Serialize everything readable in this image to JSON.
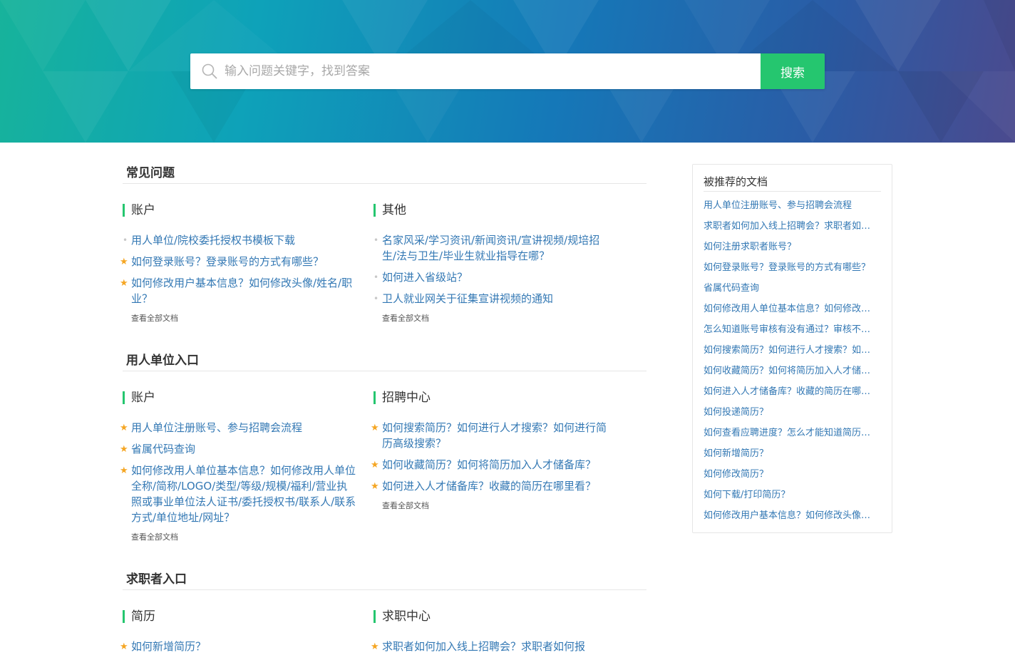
{
  "search": {
    "placeholder": "输入问题关键字，找到答案",
    "button_label": "搜索"
  },
  "sections": [
    {
      "title": "常见问题",
      "categories": [
        {
          "title": "账户",
          "items": [
            {
              "text": "用人单位/院校委托授权书模板下载",
              "starred": false
            },
            {
              "text": "如何登录账号？登录账号的方式有哪些？",
              "starred": true
            },
            {
              "text": "如何修改用户基本信息？如何修改头像/姓名/职业？",
              "starred": true
            }
          ],
          "view_all": "查看全部文档"
        },
        {
          "title": "其他",
          "items": [
            {
              "text": "名家风采/学习资讯/新闻资讯/宣讲视频/规培招生/法与卫生/毕业生就业指导在哪？",
              "starred": false
            },
            {
              "text": "如何进入省级站？",
              "starred": false
            },
            {
              "text": "卫人就业网关于征集宣讲视频的通知",
              "starred": false
            }
          ],
          "view_all": "查看全部文档"
        }
      ]
    },
    {
      "title": "用人单位入口",
      "categories": [
        {
          "title": "账户",
          "items": [
            {
              "text": "用人单位注册账号、参与招聘会流程",
              "starred": true
            },
            {
              "text": "省属代码查询",
              "starred": true
            },
            {
              "text": "如何修改用人单位基本信息？如何修改用人单位全称/简称/LOGO/类型/等级/规模/福利/营业执照或事业单位法人证书/委托授权书/联系人/联系方式/单位地址/网址？",
              "starred": true
            }
          ],
          "view_all": "查看全部文档"
        },
        {
          "title": "招聘中心",
          "items": [
            {
              "text": "如何搜索简历？如何进行人才搜索？如何进行简历高级搜索？",
              "starred": true
            },
            {
              "text": "如何收藏简历？如何将简历加入人才储备库？",
              "starred": true
            },
            {
              "text": "如何进入人才储备库？收藏的简历在哪里看？",
              "starred": true
            }
          ],
          "view_all": "查看全部文档"
        }
      ]
    },
    {
      "title": "求职者入口",
      "categories": [
        {
          "title": "简历",
          "items": [
            {
              "text": "如何新增简历？",
              "starred": true
            }
          ],
          "view_all": ""
        },
        {
          "title": "求职中心",
          "items": [
            {
              "text": "求职者如何加入线上招聘会？求职者如何报",
              "starred": true
            }
          ],
          "view_all": ""
        }
      ]
    }
  ],
  "sidebar": {
    "title": "被推荐的文档",
    "items": [
      "用人单位注册账号、参与招聘会流程",
      "求职者如何加入线上招聘会？求职者如何报名招聘会",
      "如何注册求职者账号？",
      "如何登录账号？登录账号的方式有哪些？",
      "省属代码查询",
      "如何修改用人单位基本信息？如何修改用人单位全称",
      "怎么知道账号审核有没有通过？审核不通过怎么办",
      "如何搜索简历？如何进行人才搜索？如何进行简历",
      "如何收藏简历？如何将简历加入人才储备库？",
      "如何进入人才储备库？收藏的简历在哪里看？",
      "如何投递简历？",
      "如何查看应聘进度？怎么才能知道简历被查看",
      "如何新增简历？",
      "如何修改简历？",
      "如何下载/打印简历？",
      "如何修改用户基本信息？如何修改头像/姓名/职业？"
    ]
  },
  "colors": {
    "accent_green": "#25c66f",
    "link_blue": "#3378b4",
    "star": "#f5a623"
  }
}
